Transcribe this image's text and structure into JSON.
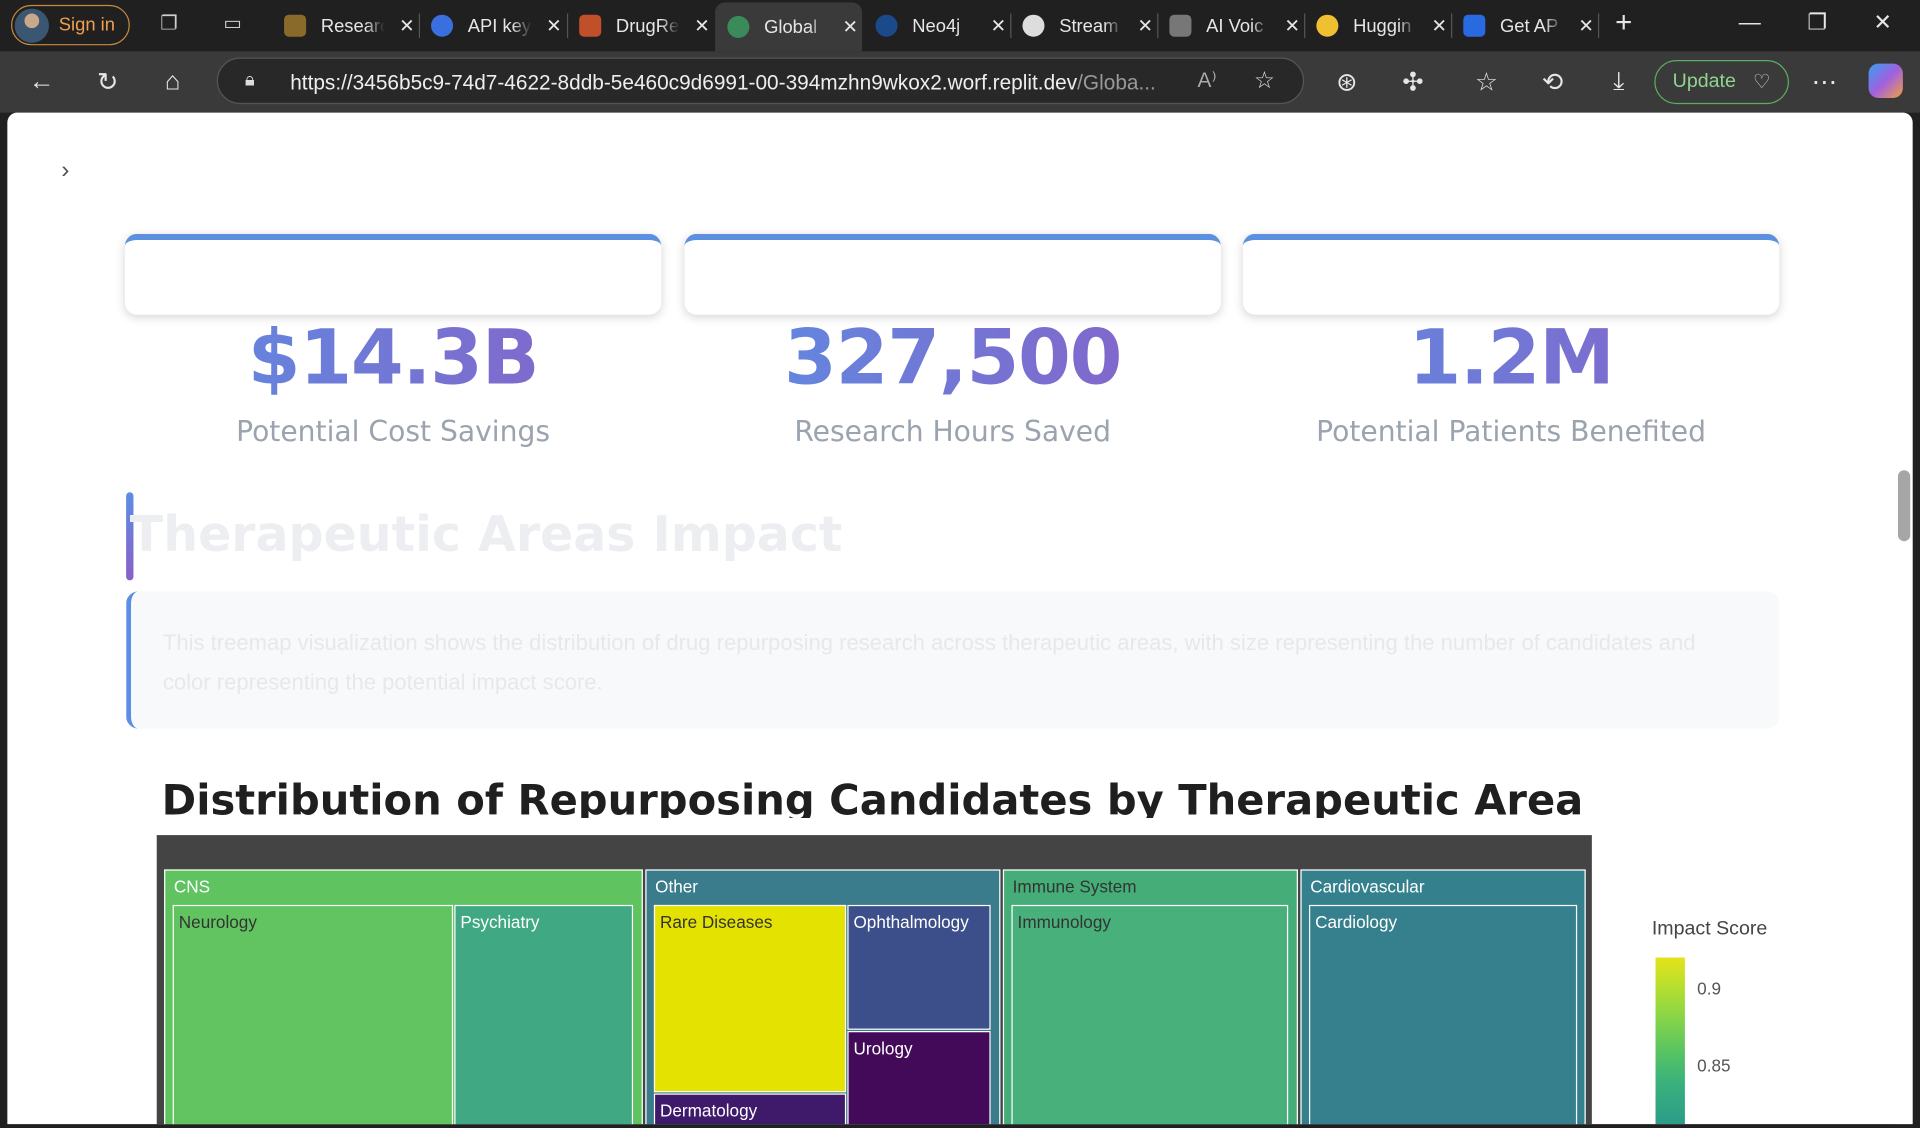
{
  "browser": {
    "signin_label": "Sign in",
    "tabs": [
      {
        "title": "Research",
        "color": "#8a6a2a"
      },
      {
        "title": "API keys",
        "color": "#3a6fe0"
      },
      {
        "title": "DrugRe",
        "color": "#c0502a"
      },
      {
        "title": "Global",
        "color": "#3a8a5a"
      },
      {
        "title": "Neo4j",
        "color": "#1a4a8a"
      },
      {
        "title": "Stream",
        "color": "#dddddd"
      },
      {
        "title": "AI Voic",
        "color": "#777777"
      },
      {
        "title": "Huggin",
        "color": "#f0c030"
      },
      {
        "title": "Get AP",
        "color": "#2a6ae0"
      }
    ],
    "active_tab_index": 3,
    "url_main": "https://3456b5c9-74d7-4622-8ddb-5e460c9d6991-00-394mzhn9wkox2.worf.replit.dev",
    "url_path": "/Globa...",
    "update_label": "Update"
  },
  "metrics": [
    {
      "value": "$14.3B",
      "label": "Potential Cost Savings"
    },
    {
      "value": "327,500",
      "label": "Research Hours Saved"
    },
    {
      "value": "1.2M",
      "label": "Potential Patients Benefited"
    }
  ],
  "section": {
    "title": "Therapeutic Areas Impact",
    "info": "This treemap visualization shows the distribution of drug repurposing research across therapeutic areas, with size representing the number of candidates and color representing the potential impact score."
  },
  "chart_data": {
    "type": "heatmap",
    "title": "Distribution of Repurposing Candidates by Therapeutic Area",
    "colorbar_title": "Impact Score",
    "colorbar_ticks": [
      "0.9",
      "0.85"
    ],
    "groups": [
      {
        "name": "CNS",
        "children": [
          "Neurology",
          "Psychiatry"
        ]
      },
      {
        "name": "Other",
        "children": [
          "Rare Diseases",
          "Ophthalmology",
          "Urology",
          "Dermatology"
        ]
      },
      {
        "name": "Immune System",
        "children": [
          "Immunology"
        ]
      },
      {
        "name": "Cardiovascular",
        "children": [
          "Cardiology"
        ]
      }
    ]
  }
}
